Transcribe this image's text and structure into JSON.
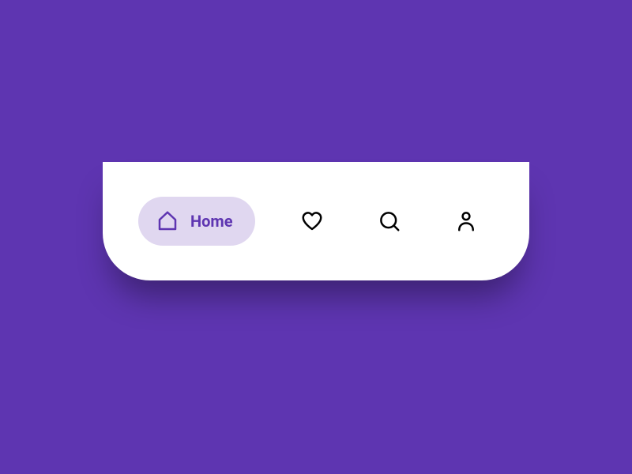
{
  "nav": {
    "items": [
      {
        "label": "Home"
      },
      {
        "label": "Favorites"
      },
      {
        "label": "Search"
      },
      {
        "label": "Profile"
      }
    ]
  },
  "colors": {
    "background": "#5e35b1",
    "pill": "#e0d7f0",
    "accent": "#5e35b1"
  }
}
